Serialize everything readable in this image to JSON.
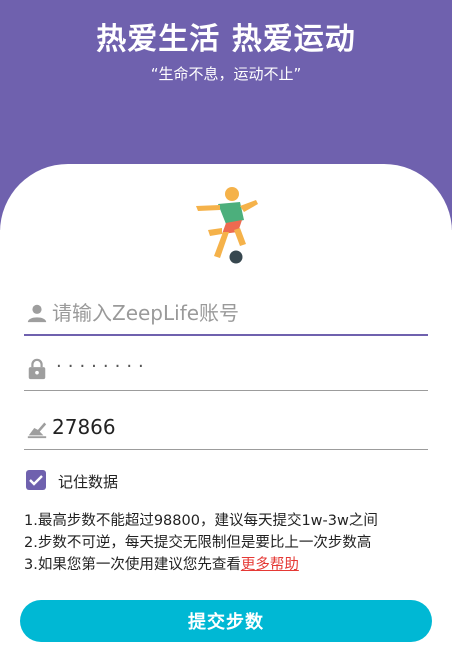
{
  "header": {
    "title": "热爱生活 热爱运动",
    "subtitle": "“生命不息，运动不止”"
  },
  "form": {
    "account": {
      "placeholder": "请输入ZeepLife账号",
      "value": ""
    },
    "password": {
      "masked_value": "········"
    },
    "steps": {
      "value": "27866"
    },
    "remember": {
      "label": "记住数据",
      "checked": true
    }
  },
  "notes": {
    "line1": "1.最高步数不能超过98800，建议每天提交1w-3w之间",
    "line2": "2.步数不可逆，每天提交无限制但是要比上一次步数高",
    "line3_text": "3.如果您第一次使用建议您先查看",
    "line3_link": "更多帮助"
  },
  "submit_label": "提交步数",
  "colors": {
    "primary": "#6f61ae",
    "accent": "#00b8d4",
    "link": "#e53935"
  },
  "icons": {
    "logo": "soccer-player-icon",
    "account": "user-icon",
    "password": "lock-icon",
    "steps": "shoe-icon",
    "checkbox": "check-icon"
  }
}
